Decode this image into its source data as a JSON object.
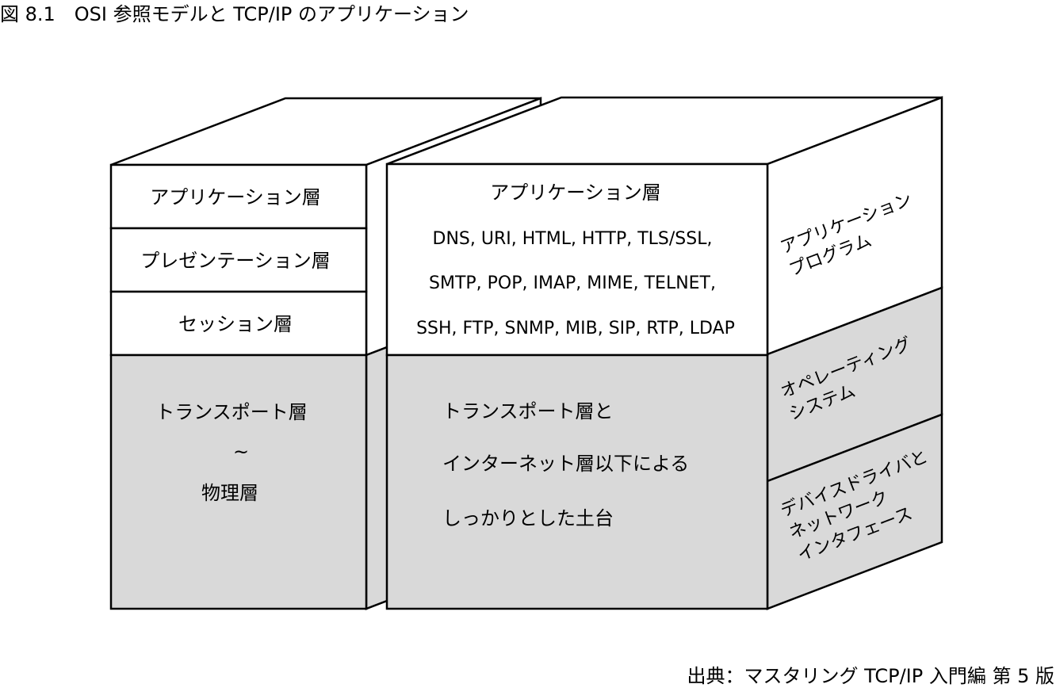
{
  "figure_title": "図 8.1　OSI 参照モデルと TCP/IP のアプリケーション",
  "source_credit": "出典：マスタリング TCP/IP 入門編 第 5 版",
  "osi_stack": {
    "application_layer": "アプリケーション層",
    "presentation_layer": "プレゼンテーション層",
    "session_layer": "セッション層",
    "lower_line1": "トランスポート層",
    "lower_tilde": "~",
    "lower_line2": "物理層"
  },
  "tcpip_stack": {
    "application_layer": "アプリケーション層",
    "protocols_line1": "DNS, URI, HTML, HTTP, TLS/SSL,",
    "protocols_line2": "SMTP, POP, IMAP, MIME, TELNET,",
    "protocols_line3": "SSH, FTP, SNMP, MIB, SIP, RTP, LDAP",
    "lower_line1": "トランスポート層と",
    "lower_line2": "インターネット層以下による",
    "lower_line3": "しっかりとした土台"
  },
  "side_labels": {
    "app_program_line1": "アプリケーション",
    "app_program_line2": "プログラム",
    "os_line1": "オペレーティング",
    "os_line2": "システム",
    "driver_line1": "デバイスドライバと",
    "driver_line2": "ネットワーク",
    "driver_line3": "インタフェース"
  },
  "colors": {
    "lower_fill": "#d9d9d9",
    "upper_fill": "#ffffff",
    "stroke": "#000000"
  }
}
